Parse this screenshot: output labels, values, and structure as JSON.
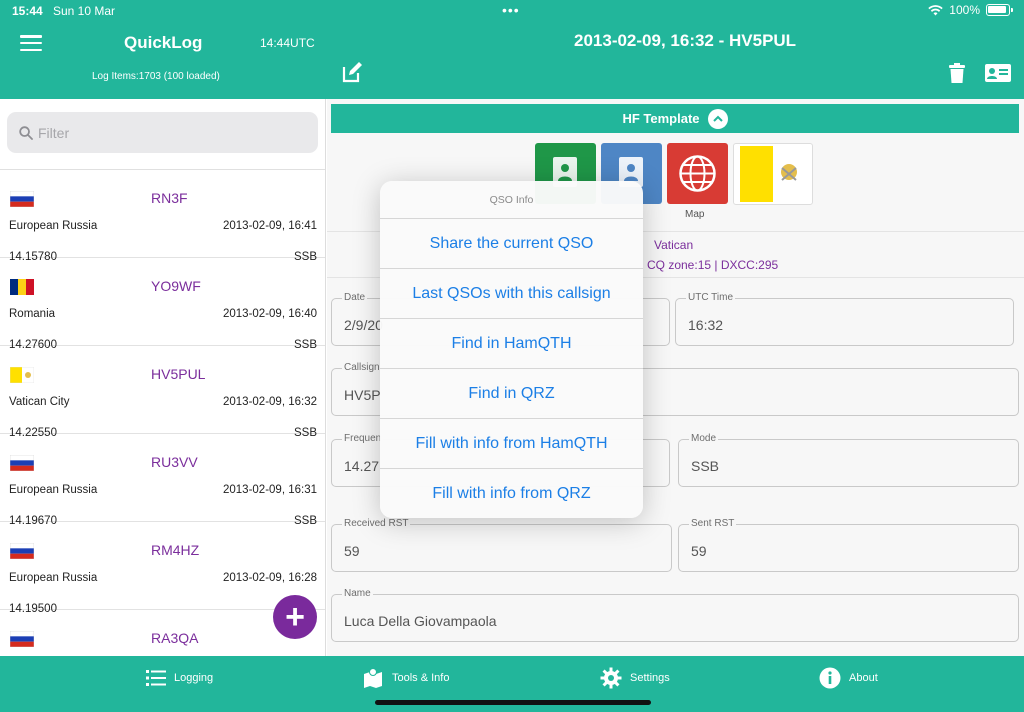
{
  "status_bar": {
    "time": "15:44",
    "date": "Sun 10 Mar",
    "battery": "100%"
  },
  "header": {
    "app_title": "QuickLog",
    "utc_time": "14:44UTC",
    "log_items": "Log Items:1703 (100 loaded)",
    "qso_title": "2013-02-09, 16:32 - HV5PUL"
  },
  "filter": {
    "placeholder": "Filter"
  },
  "log_list": [
    {
      "callsign": "RN3F",
      "country": "European Russia",
      "datetime": "2013-02-09, 16:41",
      "frequency": "14.15780",
      "mode": "SSB",
      "flag": "russia"
    },
    {
      "callsign": "YO9WF",
      "country": "Romania",
      "datetime": "2013-02-09, 16:40",
      "frequency": "14.27600",
      "mode": "SSB",
      "flag": "romania"
    },
    {
      "callsign": "HV5PUL",
      "country": "Vatican City",
      "datetime": "2013-02-09, 16:32",
      "frequency": "14.22550",
      "mode": "SSB",
      "flag": "vatican"
    },
    {
      "callsign": "RU3VV",
      "country": "European Russia",
      "datetime": "2013-02-09, 16:31",
      "frequency": "14.19670",
      "mode": "SSB",
      "flag": "russia"
    },
    {
      "callsign": "RM4HZ",
      "country": "European Russia",
      "datetime": "2013-02-09, 16:28",
      "frequency": "14.19500",
      "mode": "",
      "flag": "russia"
    },
    {
      "callsign": "RA3QA",
      "country": "",
      "datetime": "",
      "frequency": "",
      "mode": "",
      "flag": "russia"
    }
  ],
  "template": {
    "label": "HF Template"
  },
  "info": {
    "map_label": "Map",
    "country": "Vatican",
    "zones": "CQ zone:15 | DXCC:295"
  },
  "fields": {
    "date": {
      "label": "Date",
      "value": "2/9/20"
    },
    "utc_time": {
      "label": "UTC Time",
      "value": "16:32"
    },
    "callsign": {
      "label": "Callsign",
      "value": "HV5P"
    },
    "frequency": {
      "label": "Frequen",
      "value": "14.27"
    },
    "mode": {
      "label": "Mode",
      "value": "SSB"
    },
    "received_rst": {
      "label": "Received RST",
      "value": "59"
    },
    "sent_rst": {
      "label": "Sent RST",
      "value": "59"
    },
    "name": {
      "label": "Name",
      "value": "Luca Della Giovampaola"
    }
  },
  "popover": {
    "title": "QSO Info",
    "items": [
      "Share the current QSO",
      "Last QSOs with this callsign",
      "Find in HamQTH",
      "Find in QRZ",
      "Fill with info from HamQTH",
      "Fill with info from QRZ"
    ]
  },
  "tabs": [
    {
      "label": "Logging",
      "icon": "list-icon"
    },
    {
      "label": "Tools & Info",
      "icon": "map-icon"
    },
    {
      "label": "Settings",
      "icon": "gear-icon"
    },
    {
      "label": "About",
      "icon": "info-icon"
    }
  ],
  "colors": {
    "accent": "#22b69b",
    "callsign": "#7b2e9c",
    "link": "#1c7fe6",
    "fab": "#7a2a9c"
  }
}
